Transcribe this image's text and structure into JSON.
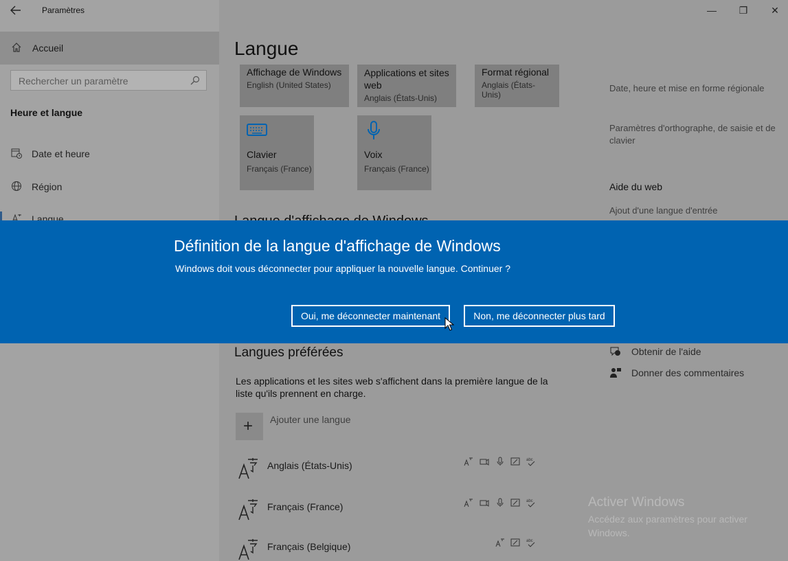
{
  "window": {
    "title": "Paramètres",
    "back_icon": "back-arrow-icon",
    "minimize_glyph": "—",
    "restore_glyph": "❐",
    "close_glyph": "✕"
  },
  "sidebar": {
    "home_label": "Accueil",
    "search_placeholder": "Rechercher un paramètre",
    "section_title": "Heure et langue",
    "items": [
      {
        "label": "Date et heure",
        "icon": "calendar-clock-icon"
      },
      {
        "label": "Région",
        "icon": "globe-icon"
      },
      {
        "label": "Langue",
        "icon": "language-icon",
        "selected": true
      }
    ]
  },
  "main": {
    "page_title": "Langue",
    "tiles": [
      {
        "title": "Affichage de Windows",
        "subtitle": "English (United States)"
      },
      {
        "title": "Applications et sites web",
        "subtitle": "Anglais (États-Unis)"
      },
      {
        "title": "Format régional",
        "subtitle": "Anglais (États-Unis)"
      },
      {
        "title": "Clavier",
        "subtitle": "Français (France)",
        "icon": "keyboard-icon"
      },
      {
        "title": "Voix",
        "subtitle": "Français (France)",
        "icon": "microphone-icon"
      }
    ],
    "display_heading": "Langue d'affichage de Windows",
    "preferred_title": "Langues préférées",
    "preferred_desc": "Les applications et les sites web s'affichent dans la première langue de la liste qu'ils prennent en charge.",
    "add_glyph": "+",
    "add_language": "Ajouter une langue",
    "languages": [
      {
        "name": "Anglais (États-Unis)"
      },
      {
        "name": "Français (France)"
      },
      {
        "name": "Français (Belgique)"
      }
    ]
  },
  "right_panel": {
    "links": [
      "Date, heure et mise en forme régionale",
      "Paramètres d'orthographe, de saisie et de clavier"
    ],
    "help_heading": "Aide du web",
    "help_link": "Ajout d'une langue d'entrée",
    "get_help": "Obtenir de l'aide",
    "feedback": "Donner des commentaires"
  },
  "dialog": {
    "title": "Définition de la langue d'affichage de Windows",
    "message": "Windows doit vous déconnecter pour appliquer la nouvelle langue. Continuer ?",
    "yes_label": "Oui, me déconnecter maintenant",
    "no_label": "Non, me déconnecter plus tard",
    "background": "#0063b1"
  },
  "activation": {
    "title": "Activer Windows",
    "subtitle": "Accédez aux paramètres pour activer Windows."
  }
}
